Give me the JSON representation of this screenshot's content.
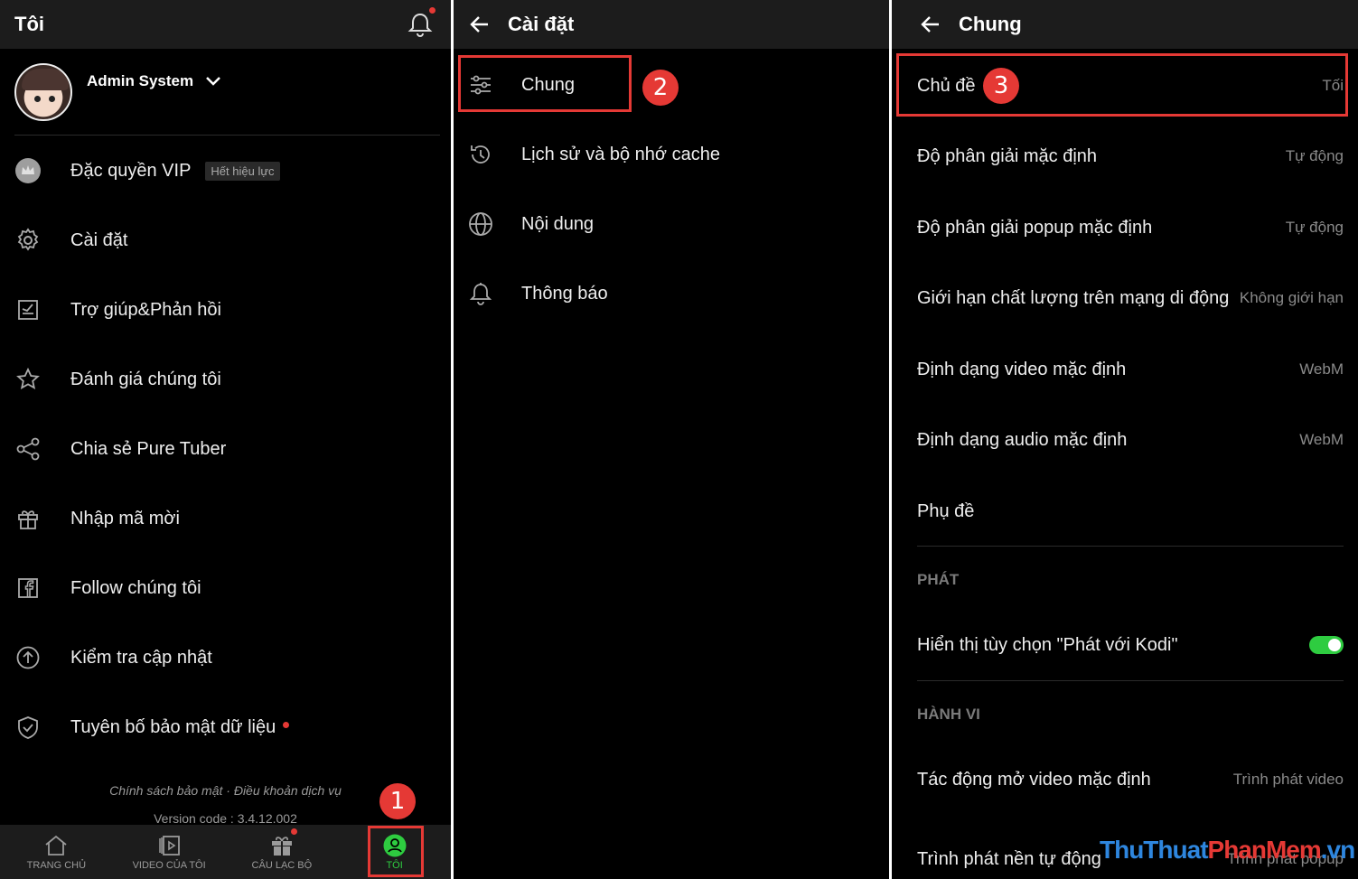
{
  "panel_left": {
    "header_title": "Tôi",
    "username": "Admin System",
    "menu": [
      {
        "icon": "crown-icon",
        "label": "Đặc quyền VIP",
        "badge": "Hết hiệu lực"
      },
      {
        "icon": "gear-icon",
        "label": "Cài đặt"
      },
      {
        "icon": "feedback-icon",
        "label": "Trợ giúp&Phản hồi"
      },
      {
        "icon": "star-icon",
        "label": "Đánh giá chúng tôi"
      },
      {
        "icon": "share-icon",
        "label": "Chia sẻ Pure Tuber"
      },
      {
        "icon": "gift-icon",
        "label": "Nhập mã mời"
      },
      {
        "icon": "facebook-icon",
        "label": "Follow chúng tôi"
      },
      {
        "icon": "upload-circle-icon",
        "label": "Kiểm tra cập nhật"
      },
      {
        "icon": "shield-icon",
        "label": "Tuyên bố bảo mật dữ liệu"
      }
    ],
    "footer_links": "Chính sách bảo mật · Điều khoản dịch vụ",
    "version": "Version code : 3.4.12.002",
    "nav": [
      {
        "icon": "home-icon",
        "label": "TRANG CHỦ"
      },
      {
        "icon": "video-library-icon",
        "label": "VIDEO CỦA TÔI"
      },
      {
        "icon": "gift-icon",
        "label": "CÂU LẠC BỘ"
      },
      {
        "icon": "person-icon",
        "label": "TÔI"
      }
    ]
  },
  "panel_middle": {
    "header_title": "Cài đặt",
    "items": [
      {
        "icon": "sliders-icon",
        "label": "Chung"
      },
      {
        "icon": "history-icon",
        "label": "Lịch sử và bộ nhớ cache"
      },
      {
        "icon": "globe-icon",
        "label": "Nội dung"
      },
      {
        "icon": "bell-icon",
        "label": "Thông báo"
      }
    ]
  },
  "panel_right": {
    "header_title": "Chung",
    "rows": [
      {
        "label": "Chủ đề",
        "value": "Tối"
      },
      {
        "label": "Độ phân giải mặc định",
        "value": "Tự động"
      },
      {
        "label": "Độ phân giải popup mặc định",
        "value": "Tự động"
      },
      {
        "label": "Giới hạn chất lượng trên mạng di động",
        "value": "Không giới hạn"
      },
      {
        "label": "Định dạng video mặc định",
        "value": "WebM"
      },
      {
        "label": "Định dạng audio mặc định",
        "value": "WebM"
      },
      {
        "label": "Phụ đề",
        "value": ""
      }
    ],
    "section_play": "PHÁT",
    "kodi_label": "Hiển thị tùy chọn \"Phát với Kodi\"",
    "kodi_enabled": true,
    "section_behavior": "HÀNH VI",
    "behavior_rows": [
      {
        "label": "Tác động mở video mặc định",
        "value": "Trình phát video"
      },
      {
        "label": "Trình phát nền tự động",
        "value": "Trình phát popup"
      }
    ]
  },
  "annotations": {
    "step1": "1",
    "step2": "2",
    "step3": "3"
  },
  "watermark": {
    "part1": "ThuThuat",
    "part2": "PhanMem",
    "part3": ".vn"
  },
  "colors": {
    "accent_green": "#2ecc40",
    "highlight_red": "#e53935",
    "background": "#000000",
    "header_bg": "#1c1c1c"
  }
}
